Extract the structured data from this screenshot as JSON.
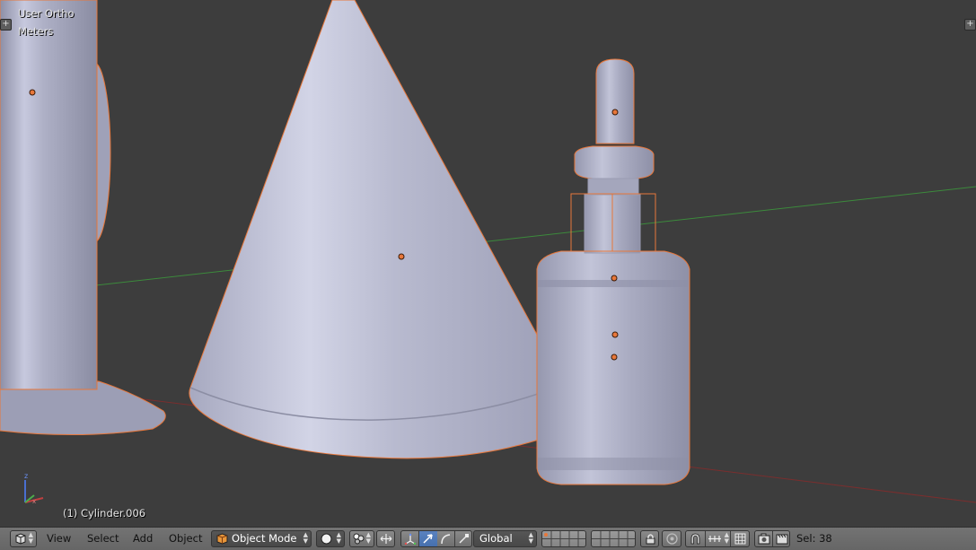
{
  "viewport": {
    "view_name": "User Ortho",
    "units": "Meters",
    "active_object": "(1) Cylinder.006"
  },
  "header": {
    "menus": [
      "View",
      "Select",
      "Add",
      "Object"
    ],
    "mode": "Object Mode",
    "orientation": "Global",
    "selection_count": "Sel: 38"
  },
  "colors": {
    "viewport_bg": "#3d3d3d",
    "object_fill": "#b4b6cc",
    "selection_outline": "#e8773a",
    "x_axis": "#8b2f2f",
    "y_axis": "#3d8a3d",
    "header_bg": "#6b6b6b",
    "active_button": "#4a74b4"
  },
  "icons": {
    "editor_type": "3d-view-icon",
    "mode": "object-mode-cube-icon",
    "shading": "solid-sphere-icon",
    "pivot": "pivot-icon",
    "manipulator": "manipulator-axes-icon",
    "layers": "layer-grid-icon",
    "lock": "lock-icon",
    "proportional": "proportional-edit-icon",
    "snap": "snap-magnet-icon",
    "render": "render-camera-icon"
  }
}
